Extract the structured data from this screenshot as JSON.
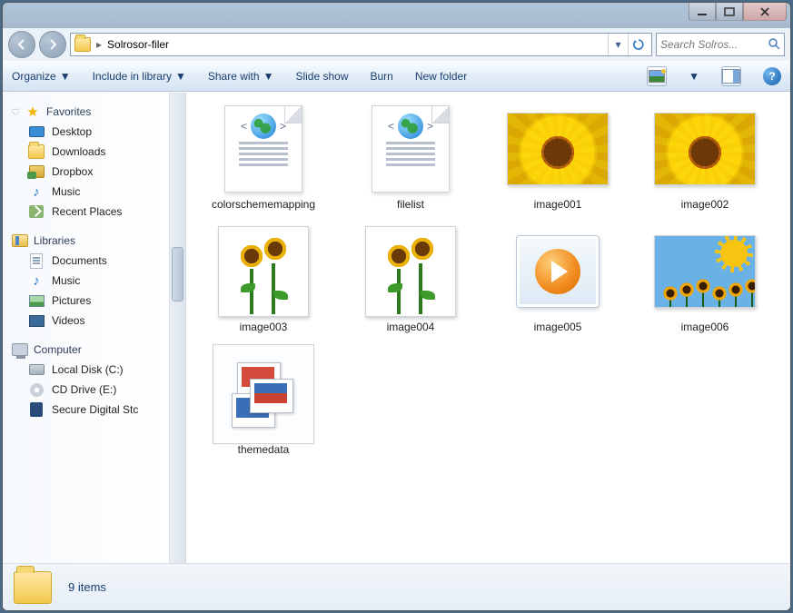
{
  "titlebar": {
    "title": ""
  },
  "breadcrumb": {
    "folder": "Solrosor-filer"
  },
  "search": {
    "placeholder": "Search Solros..."
  },
  "toolbar": {
    "organize": "Organize",
    "include": "Include in library",
    "share": "Share with",
    "slideshow": "Slide show",
    "burn": "Burn",
    "newfolder": "New folder"
  },
  "sidebar": {
    "favorites": {
      "label": "Favorites",
      "items": [
        "Desktop",
        "Downloads",
        "Dropbox",
        "Music",
        "Recent Places"
      ]
    },
    "libraries": {
      "label": "Libraries",
      "items": [
        "Documents",
        "Music",
        "Pictures",
        "Videos"
      ]
    },
    "computer": {
      "label": "Computer",
      "items": [
        "Local Disk (C:)",
        "CD Drive (E:)",
        "Secure Digital Stc"
      ]
    }
  },
  "files": [
    {
      "name": "colorschememapping",
      "type": "webdoc"
    },
    {
      "name": "filelist",
      "type": "webdoc"
    },
    {
      "name": "image001",
      "type": "sunflower-close"
    },
    {
      "name": "image002",
      "type": "sunflower-close"
    },
    {
      "name": "image003",
      "type": "sunflower-full"
    },
    {
      "name": "image004",
      "type": "sunflower-full"
    },
    {
      "name": "image005",
      "type": "media"
    },
    {
      "name": "image006",
      "type": "clipart"
    },
    {
      "name": "themedata",
      "type": "theme"
    }
  ],
  "status": {
    "count": "9 items"
  }
}
